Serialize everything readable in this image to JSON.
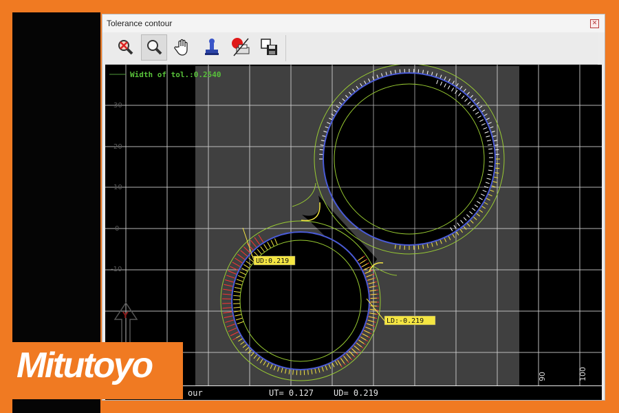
{
  "window": {
    "title": "Tolerance contour",
    "close_glyph": "✕"
  },
  "toolbar": {
    "items": [
      {
        "icon": "zoom-cancel-icon",
        "active": false
      },
      {
        "icon": "zoom-icon",
        "active": true
      },
      {
        "icon": "hand-pan-icon",
        "active": false
      },
      {
        "icon": "stamp-icon",
        "active": false
      },
      {
        "icon": "print-icon",
        "active": false
      },
      {
        "icon": "save-image-icon",
        "active": false
      }
    ]
  },
  "plot": {
    "width_of_tol_label": "Width of tol.:0.2540",
    "y_ticks": [
      "30",
      "20",
      "10",
      "0",
      "-10"
    ],
    "x_ticks": [
      "90",
      "100"
    ],
    "axis_label_y": "Y",
    "ud_label": "UD:0.219",
    "ld_label": "LD:-0.219",
    "colors": {
      "tolerance_band": "#9acd32",
      "upper_deviation": "#f5e642",
      "lower_deviation": "#ff3333",
      "contour": "#4a5bd6",
      "grid": "#cfcfcf",
      "label_bg": "#f5e642"
    }
  },
  "readout": {
    "row1_left": "our",
    "row1_ut": "UT= 0.127",
    "row1_ud": "UD= 0.219"
  },
  "logo": {
    "text": "Mitutoyo"
  }
}
